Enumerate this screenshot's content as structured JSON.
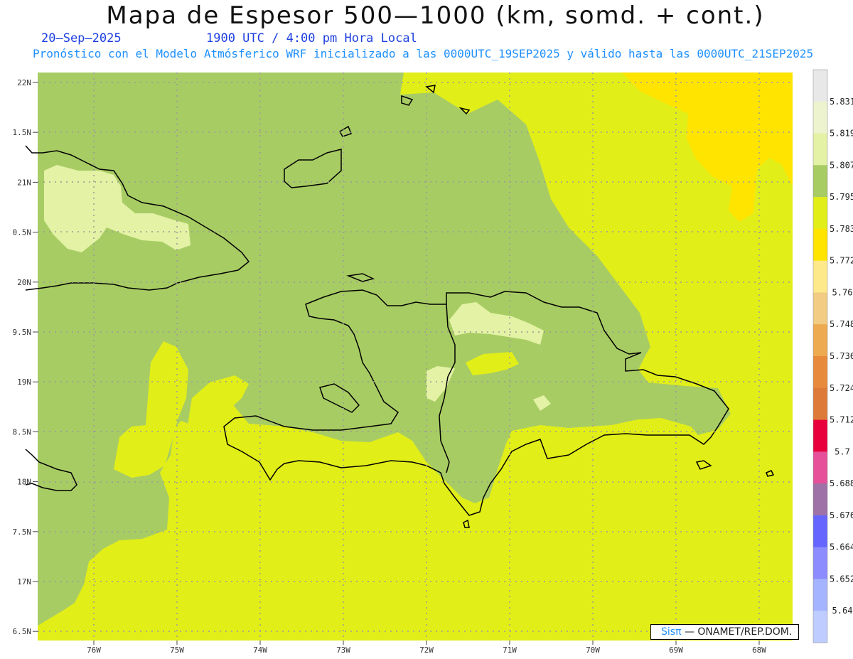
{
  "title": "Mapa de Espesor 500—1000 (km, somd. + cont.)",
  "date": "20—Sep—2025",
  "time": "1900 UTC / 4:00 pm Hora Local",
  "forecast": "Pronóstico con el Modelo Atmósferico WRF inicializado a las 0000UTC_19SEP2025 y válido hasta las  0000UTC_21SEP2025",
  "credit": {
    "brand": "Sisπ",
    "text": "— ONAMET/REP.DOM."
  },
  "axes": {
    "lat_labels": [
      "22N",
      "1.5N",
      "21N",
      "0.5N",
      "20N",
      "9.5N",
      "19N",
      "8.5N",
      "18N",
      "7.5N",
      "17N",
      "6.5N"
    ],
    "lon_labels": [
      "76W",
      "75W",
      "74W",
      "73W",
      "72W",
      "71W",
      "70W",
      "69W",
      "68W"
    ]
  },
  "colorbar": {
    "labels": [
      "5.831",
      "5.819",
      "5.807",
      "5.795",
      "5.783",
      "5.772",
      "5.76",
      "5.748",
      "5.736",
      "5.724",
      "5.712",
      "5.7",
      "5.688",
      "5.676",
      "5.664",
      "5.652",
      "5.64"
    ],
    "colors": [
      "#e8e8e8",
      "#eef3cf",
      "#e3f2a4",
      "#a8cc64",
      "#e2ee18",
      "#ffe400",
      "#fde98a",
      "#f1cc82",
      "#eeaa50",
      "#e88a3c",
      "#dd7a3a",
      "#e8003c",
      "#e6509a",
      "#9e72a6",
      "#6666ff",
      "#8c8cff",
      "#a4b4ff",
      "#bfccff"
    ]
  },
  "regions": {
    "colors": {
      "ocean": "#e2ee18",
      "mid": "#a8cc64",
      "light": "#e3f2a4",
      "yellow": "#ffe400"
    }
  }
}
